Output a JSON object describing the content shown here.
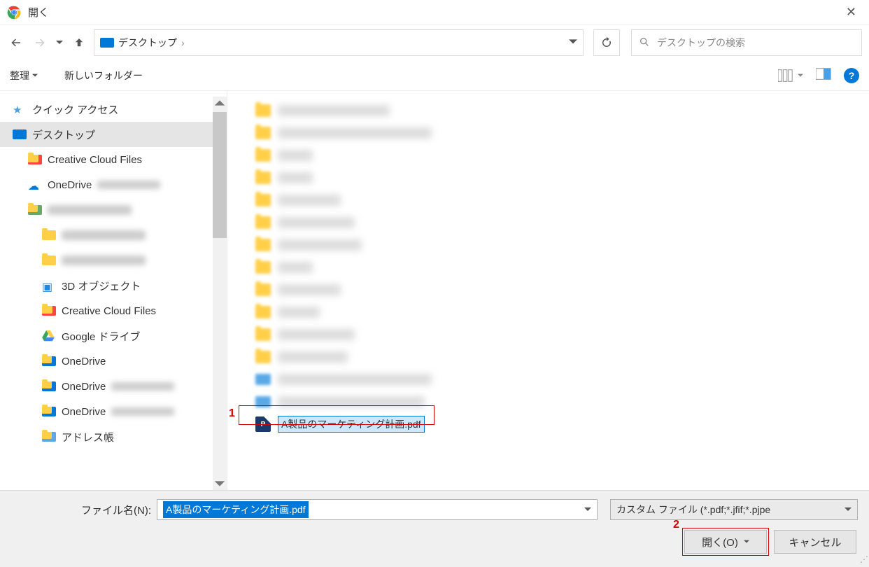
{
  "title": "開く",
  "breadcrumb": {
    "location": "デスクトップ"
  },
  "search": {
    "placeholder": "デスクトップの検索"
  },
  "toolbar": {
    "organize": "整理",
    "new_folder": "新しいフォルダー"
  },
  "tree": [
    {
      "label": "クイック アクセス",
      "icon": "star",
      "indent": 0
    },
    {
      "label": "デスクトップ",
      "icon": "monitor",
      "indent": 0,
      "selected": true
    },
    {
      "label": "Creative Cloud Files",
      "icon": "folder-cc",
      "indent": 1
    },
    {
      "label": "OneDrive",
      "icon": "cloud",
      "indent": 1,
      "blurred_suffix": true
    },
    {
      "label": "",
      "icon": "folder-user",
      "indent": 1,
      "blurred": true
    },
    {
      "label": "",
      "icon": "folder",
      "indent": 2,
      "blurred": true
    },
    {
      "label": "",
      "icon": "folder",
      "indent": 2,
      "blurred": true
    },
    {
      "label": "3D オブジェクト",
      "icon": "cube",
      "indent": 2
    },
    {
      "label": "Creative Cloud Files",
      "icon": "folder-cc",
      "indent": 2
    },
    {
      "label": "Google ドライブ",
      "icon": "gdrive",
      "indent": 2
    },
    {
      "label": "OneDrive",
      "icon": "folder-od",
      "indent": 2
    },
    {
      "label": "OneDrive",
      "icon": "folder-od",
      "indent": 2,
      "blurred_suffix": true
    },
    {
      "label": "OneDrive",
      "icon": "folder-od",
      "indent": 2,
      "blurred_suffix": true
    },
    {
      "label": "アドレス帳",
      "icon": "folder-ab",
      "indent": 2
    }
  ],
  "files": {
    "blurred_count": 14,
    "selected": {
      "name": "A製品のマーケティング計画.pdf"
    }
  },
  "footer": {
    "filename_label": "ファイル名(N):",
    "filename_value": "A製品のマーケティング計画.pdf",
    "filetype": "カスタム ファイル (*.pdf;*.jfif;*.pjpe",
    "open": "開く(O)",
    "cancel": "キャンセル"
  },
  "annotations": {
    "a1": "1",
    "a2": "2"
  }
}
